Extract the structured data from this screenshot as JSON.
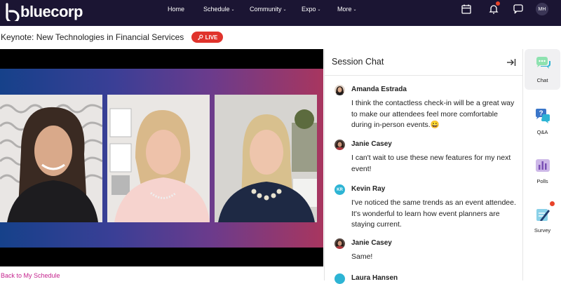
{
  "app": {
    "logo_text": "bluecorp"
  },
  "nav": {
    "items": [
      {
        "label": "Home",
        "has_menu": false
      },
      {
        "label": "Schedule",
        "has_menu": true
      },
      {
        "label": "Community",
        "has_menu": true
      },
      {
        "label": "Expo",
        "has_menu": true
      },
      {
        "label": "More",
        "has_menu": true
      }
    ],
    "icons": [
      "calendar-icon",
      "bell-icon",
      "message-icon"
    ],
    "avatar_initials": "MH"
  },
  "session": {
    "title": "Keynote: New Technologies in Financial Services",
    "live_label": "LIVE"
  },
  "back_link": "Back to My Schedule",
  "chat": {
    "title": "Session Chat",
    "messages": [
      {
        "name": "Amanda Estrada",
        "text": "I think the contactless check-in will be a great way to make our attendees feel more comfortable during in-person events.",
        "emoji": "😀",
        "avatar": "photo"
      },
      {
        "name": "Janie Casey",
        "text": "I can't wait to use these new features for my next event!",
        "avatar": "photo"
      },
      {
        "name": "Kevin Ray",
        "initials": "KR",
        "text": "I've noticed the same trends as an event attendee.  It's wonderful to learn how event planners are staying current.",
        "avatar": "initials"
      },
      {
        "name": "Janie Casey",
        "text": "Same!",
        "avatar": "photo"
      },
      {
        "name": "Laura Hansen",
        "text": "",
        "avatar": "initials"
      }
    ]
  },
  "rail": {
    "items": [
      {
        "label": "Chat",
        "icon": "chat-bubbles-icon",
        "active": true
      },
      {
        "label": "Q&A",
        "icon": "question-icon",
        "active": false
      },
      {
        "label": "Polls",
        "icon": "bar-chart-icon",
        "active": false
      },
      {
        "label": "Survey",
        "icon": "clipboard-pen-icon",
        "active": false,
        "notification": true
      }
    ]
  },
  "colors": {
    "topbar": "#1b1533",
    "live": "#e0332c",
    "link": "#c4238d",
    "accent": "#2db4d4",
    "notification": "#e8432a"
  }
}
